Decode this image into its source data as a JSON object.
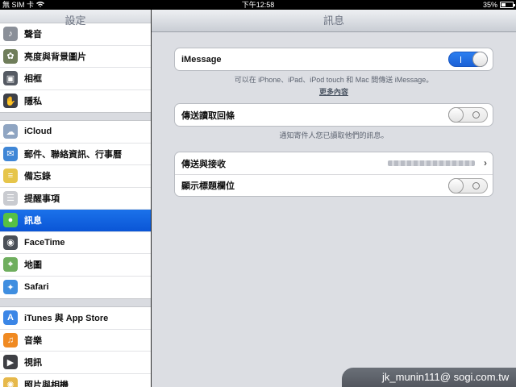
{
  "statusbar": {
    "carrier": "無 SIM 卡",
    "time": "下午12:58",
    "battery_text": "35%",
    "battery_level": 0.35
  },
  "master": {
    "title": "設定",
    "groups": [
      [
        {
          "label": "聲音",
          "icon": "speaker-icon",
          "color": "#8a8f98"
        },
        {
          "label": "亮度與背景圖片",
          "icon": "flower-icon",
          "color": "#6f7d5a"
        },
        {
          "label": "相框",
          "icon": "picture-frame-icon",
          "color": "#555a63"
        },
        {
          "label": "隱私",
          "icon": "hand-icon",
          "color": "#3d4048"
        }
      ],
      [
        {
          "label": "iCloud",
          "icon": "cloud-icon",
          "color": "#8fa5c2"
        },
        {
          "label": "郵件、聯絡資訊、行事曆",
          "icon": "mail-icon",
          "color": "#3f86d6"
        },
        {
          "label": "備忘錄",
          "icon": "notes-icon",
          "color": "#e6c54a"
        },
        {
          "label": "提醒事項",
          "icon": "reminders-icon",
          "color": "#c9cbd0"
        },
        {
          "label": "訊息",
          "icon": "messages-icon",
          "color": "#56c045",
          "selected": true
        },
        {
          "label": "FaceTime",
          "icon": "facetime-icon",
          "color": "#4a4f57"
        },
        {
          "label": "地圖",
          "icon": "map-icon",
          "color": "#6fae5e"
        },
        {
          "label": "Safari",
          "icon": "compass-icon",
          "color": "#3f8ee0"
        }
      ],
      [
        {
          "label": "iTunes 與 App Store",
          "icon": "app-store-icon",
          "color": "#3b86e6"
        },
        {
          "label": "音樂",
          "icon": "music-icon",
          "color": "#f08a22"
        },
        {
          "label": "視訊",
          "icon": "video-icon",
          "color": "#3e3f44"
        },
        {
          "label": "照片與相機",
          "icon": "photos-icon",
          "color": "#e6b84a"
        }
      ]
    ]
  },
  "detail": {
    "title": "訊息",
    "imessage_label": "iMessage",
    "imessage_toggle": "on",
    "imessage_footer": "可以在 iPhone、iPad、iPod touch 和 Mac 間傳送 iMessage。",
    "more_link": "更多內容",
    "read_receipts_label": "傳送讀取回條",
    "read_receipts_toggle": "off",
    "read_receipts_footer": "通知寄件人您已讀取他們的訊息。",
    "send_receive_label": "傳送與接收",
    "show_subject_label": "顯示標題欄位",
    "show_subject_toggle": "off"
  },
  "watermark": "jk_munin111@ sogi.com.tw"
}
